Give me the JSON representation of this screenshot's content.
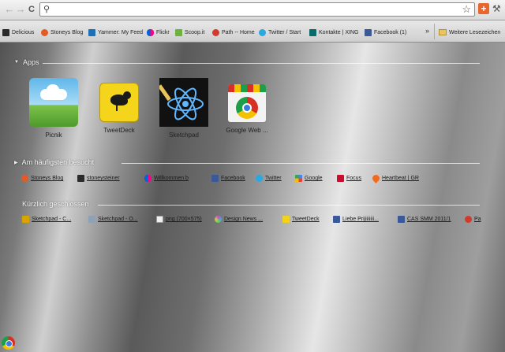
{
  "toolbar": {
    "back_icon": "←",
    "forward_icon": "→",
    "reload_icon": "C",
    "address_value": "",
    "star_icon": "☆"
  },
  "bookmarks": {
    "items": [
      {
        "label": "Delicious",
        "color": "#2b2b2b"
      },
      {
        "label": "Stoneys Blog",
        "color": "#e35b22"
      },
      {
        "label": "Yammer: My Feed",
        "color": "#1d6fb8"
      },
      {
        "label": "Flickr",
        "color": "#ff0084"
      },
      {
        "label": "Scoop.it",
        "color": "#6cb33f"
      },
      {
        "label": "Path -- Home",
        "color": "#d23a2b"
      },
      {
        "label": "Twitter / Start",
        "color": "#2aa9e0"
      },
      {
        "label": "Kontakte | XING",
        "color": "#0a6b6b"
      },
      {
        "label": "Facebook (1)",
        "color": "#3b5998"
      }
    ],
    "other_label": "Weitere Lesezeichen"
  },
  "sections": {
    "apps": "Apps",
    "most_visited": "Am häufigsten besucht",
    "recently_closed": "Kürzlich geschlossen"
  },
  "apps": [
    {
      "label": "Picnik"
    },
    {
      "label": "TweetDeck"
    },
    {
      "label": "Sketchpad"
    },
    {
      "label": "Google Web ..."
    }
  ],
  "most_visited": [
    {
      "label": "Stoneys Blog",
      "color": "#e35b22"
    },
    {
      "label": "stoneysteiner",
      "color": "#2b2b2b"
    },
    {
      "label": "Willkommen b",
      "color": "#ff0084"
    },
    {
      "label": "Facebook",
      "color": "#3b5998"
    },
    {
      "label": "Twitter",
      "color": "#2aa9e0"
    },
    {
      "label": "Google",
      "color": "#2a8c3a"
    },
    {
      "label": "Focus",
      "color": "#c8102e"
    },
    {
      "label": "Heartbeat | GR",
      "color": "#f26b1d"
    }
  ],
  "recently_closed": [
    {
      "label": "Sketchpad - C...",
      "color": "#d9a300"
    },
    {
      "label": "Sketchpad - O...",
      "color": "#8fa1b5"
    },
    {
      "label": "png (700×575)",
      "color": "#f0f0f0"
    },
    {
      "label": "Design News ...",
      "color": "#c94fd0"
    },
    {
      "label": "TweetDeck",
      "color": "#f2d21f"
    },
    {
      "label": "Liebe Prijiiiiiii...",
      "color": "#3b5998"
    },
    {
      "label": "CAS SMM 2011/1",
      "color": "#3b5998"
    },
    {
      "label": "Pa",
      "color": "#d23a2b"
    }
  ]
}
